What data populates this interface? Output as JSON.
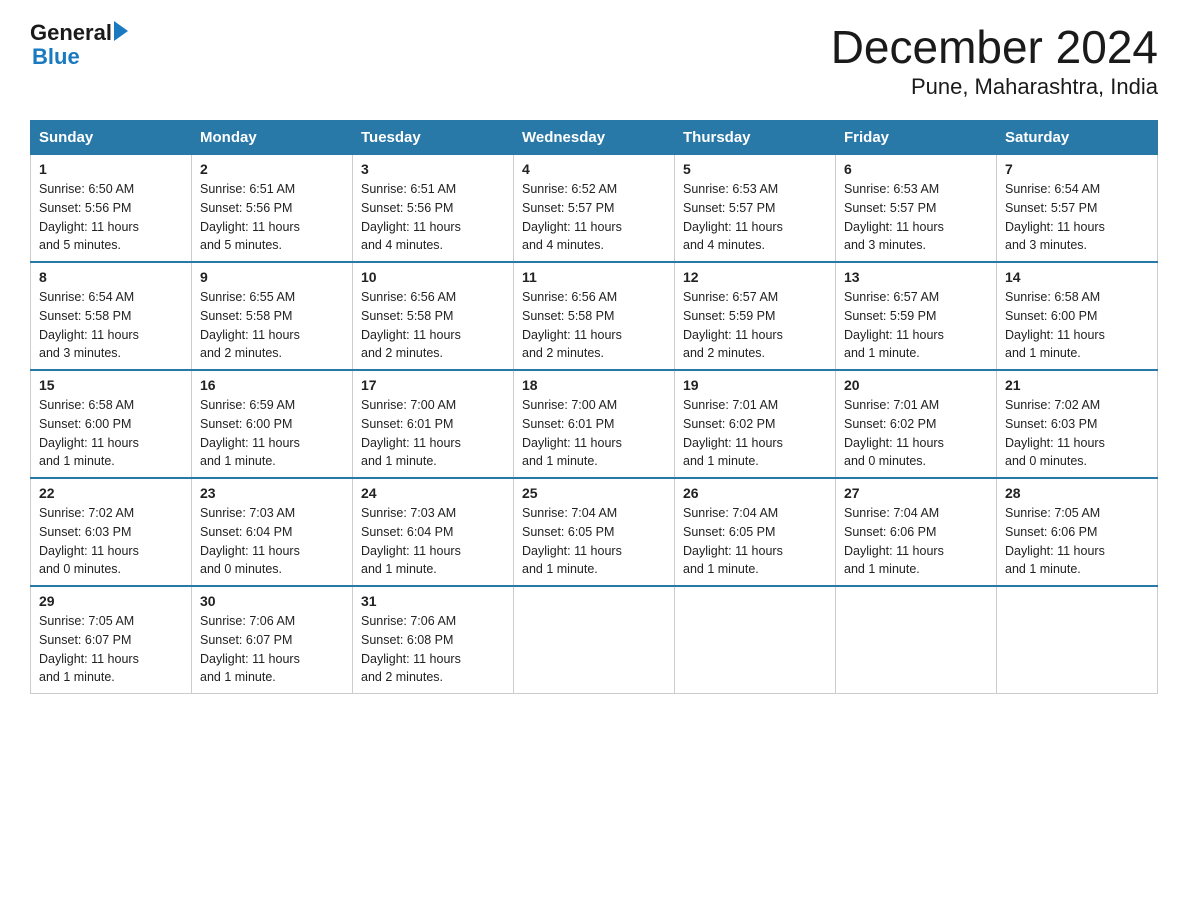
{
  "header": {
    "logo_general": "General",
    "logo_blue": "Blue",
    "month_year": "December 2024",
    "location": "Pune, Maharashtra, India"
  },
  "days_of_week": [
    "Sunday",
    "Monday",
    "Tuesday",
    "Wednesday",
    "Thursday",
    "Friday",
    "Saturday"
  ],
  "weeks": [
    [
      {
        "day": "1",
        "sunrise": "6:50 AM",
        "sunset": "5:56 PM",
        "daylight": "11 hours and 5 minutes."
      },
      {
        "day": "2",
        "sunrise": "6:51 AM",
        "sunset": "5:56 PM",
        "daylight": "11 hours and 5 minutes."
      },
      {
        "day": "3",
        "sunrise": "6:51 AM",
        "sunset": "5:56 PM",
        "daylight": "11 hours and 4 minutes."
      },
      {
        "day": "4",
        "sunrise": "6:52 AM",
        "sunset": "5:57 PM",
        "daylight": "11 hours and 4 minutes."
      },
      {
        "day": "5",
        "sunrise": "6:53 AM",
        "sunset": "5:57 PM",
        "daylight": "11 hours and 4 minutes."
      },
      {
        "day": "6",
        "sunrise": "6:53 AM",
        "sunset": "5:57 PM",
        "daylight": "11 hours and 3 minutes."
      },
      {
        "day": "7",
        "sunrise": "6:54 AM",
        "sunset": "5:57 PM",
        "daylight": "11 hours and 3 minutes."
      }
    ],
    [
      {
        "day": "8",
        "sunrise": "6:54 AM",
        "sunset": "5:58 PM",
        "daylight": "11 hours and 3 minutes."
      },
      {
        "day": "9",
        "sunrise": "6:55 AM",
        "sunset": "5:58 PM",
        "daylight": "11 hours and 2 minutes."
      },
      {
        "day": "10",
        "sunrise": "6:56 AM",
        "sunset": "5:58 PM",
        "daylight": "11 hours and 2 minutes."
      },
      {
        "day": "11",
        "sunrise": "6:56 AM",
        "sunset": "5:58 PM",
        "daylight": "11 hours and 2 minutes."
      },
      {
        "day": "12",
        "sunrise": "6:57 AM",
        "sunset": "5:59 PM",
        "daylight": "11 hours and 2 minutes."
      },
      {
        "day": "13",
        "sunrise": "6:57 AM",
        "sunset": "5:59 PM",
        "daylight": "11 hours and 1 minute."
      },
      {
        "day": "14",
        "sunrise": "6:58 AM",
        "sunset": "6:00 PM",
        "daylight": "11 hours and 1 minute."
      }
    ],
    [
      {
        "day": "15",
        "sunrise": "6:58 AM",
        "sunset": "6:00 PM",
        "daylight": "11 hours and 1 minute."
      },
      {
        "day": "16",
        "sunrise": "6:59 AM",
        "sunset": "6:00 PM",
        "daylight": "11 hours and 1 minute."
      },
      {
        "day": "17",
        "sunrise": "7:00 AM",
        "sunset": "6:01 PM",
        "daylight": "11 hours and 1 minute."
      },
      {
        "day": "18",
        "sunrise": "7:00 AM",
        "sunset": "6:01 PM",
        "daylight": "11 hours and 1 minute."
      },
      {
        "day": "19",
        "sunrise": "7:01 AM",
        "sunset": "6:02 PM",
        "daylight": "11 hours and 1 minute."
      },
      {
        "day": "20",
        "sunrise": "7:01 AM",
        "sunset": "6:02 PM",
        "daylight": "11 hours and 0 minutes."
      },
      {
        "day": "21",
        "sunrise": "7:02 AM",
        "sunset": "6:03 PM",
        "daylight": "11 hours and 0 minutes."
      }
    ],
    [
      {
        "day": "22",
        "sunrise": "7:02 AM",
        "sunset": "6:03 PM",
        "daylight": "11 hours and 0 minutes."
      },
      {
        "day": "23",
        "sunrise": "7:03 AM",
        "sunset": "6:04 PM",
        "daylight": "11 hours and 0 minutes."
      },
      {
        "day": "24",
        "sunrise": "7:03 AM",
        "sunset": "6:04 PM",
        "daylight": "11 hours and 1 minute."
      },
      {
        "day": "25",
        "sunrise": "7:04 AM",
        "sunset": "6:05 PM",
        "daylight": "11 hours and 1 minute."
      },
      {
        "day": "26",
        "sunrise": "7:04 AM",
        "sunset": "6:05 PM",
        "daylight": "11 hours and 1 minute."
      },
      {
        "day": "27",
        "sunrise": "7:04 AM",
        "sunset": "6:06 PM",
        "daylight": "11 hours and 1 minute."
      },
      {
        "day": "28",
        "sunrise": "7:05 AM",
        "sunset": "6:06 PM",
        "daylight": "11 hours and 1 minute."
      }
    ],
    [
      {
        "day": "29",
        "sunrise": "7:05 AM",
        "sunset": "6:07 PM",
        "daylight": "11 hours and 1 minute."
      },
      {
        "day": "30",
        "sunrise": "7:06 AM",
        "sunset": "6:07 PM",
        "daylight": "11 hours and 1 minute."
      },
      {
        "day": "31",
        "sunrise": "7:06 AM",
        "sunset": "6:08 PM",
        "daylight": "11 hours and 2 minutes."
      },
      null,
      null,
      null,
      null
    ]
  ]
}
